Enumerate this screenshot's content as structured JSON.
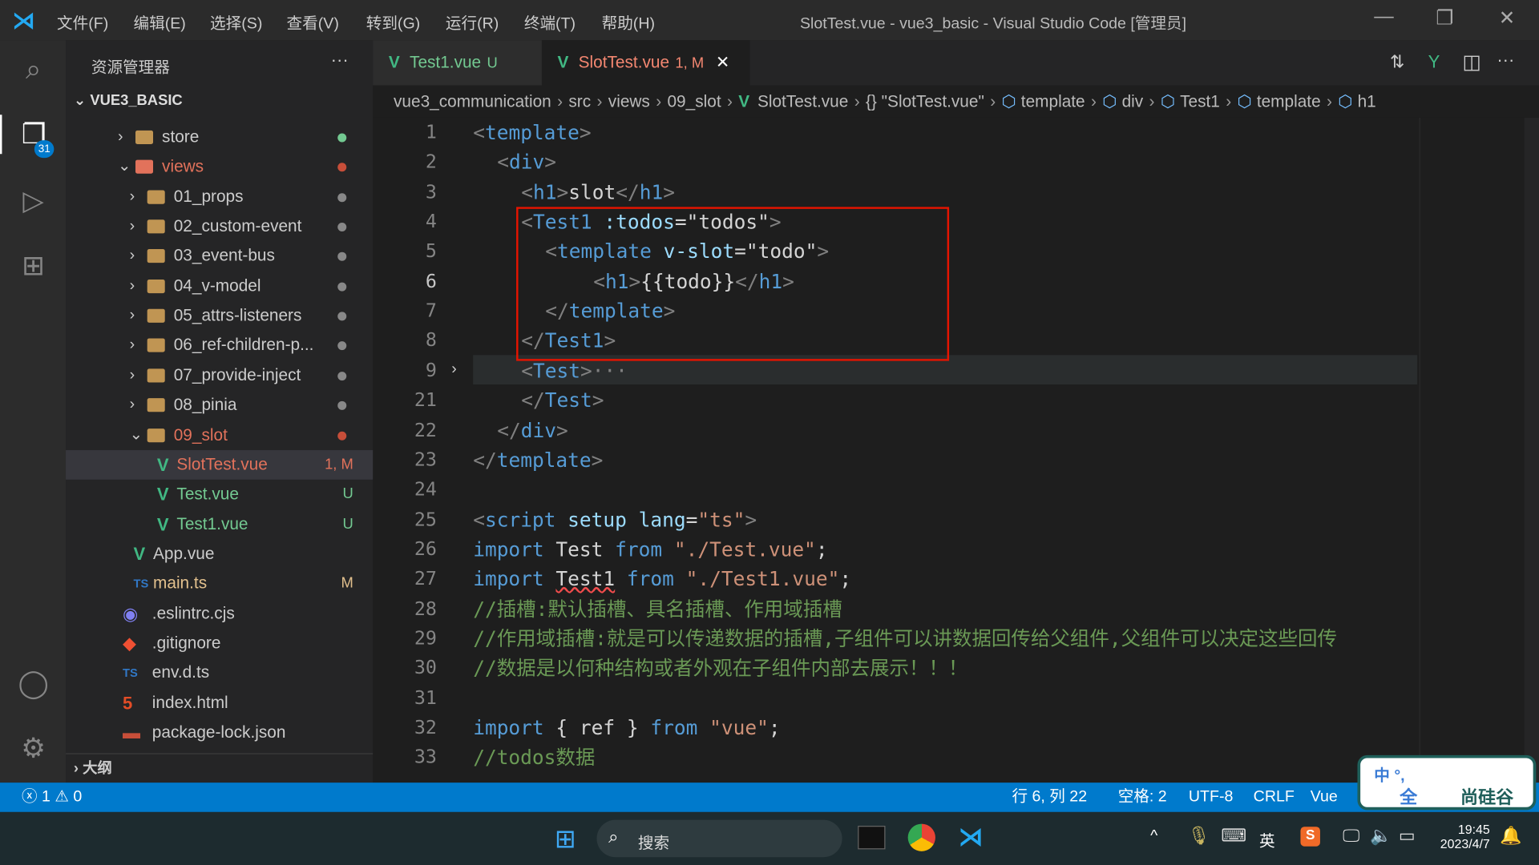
{
  "titlebar": {
    "menus": [
      "文件(F)",
      "编辑(E)",
      "选择(S)",
      "查看(V)",
      "转到(G)",
      "运行(R)",
      "终端(T)",
      "帮助(H)"
    ],
    "title": "SlotTest.vue - vue3_basic - Visual Studio Code [管理员]"
  },
  "activity": {
    "explorer_badge": "31"
  },
  "sidebar": {
    "header": "资源管理器",
    "more": "···",
    "root": "VUE3_BASIC",
    "outline": "大纲",
    "items": [
      {
        "label": "store",
        "type": "folder",
        "level": 0,
        "open": false,
        "dot": "#73c991"
      },
      {
        "label": "views",
        "type": "folder-special",
        "level": 0,
        "open": true,
        "dot": "#c74e39",
        "color": "#e2725b"
      },
      {
        "label": "01_props",
        "type": "folder",
        "level": 1,
        "open": false,
        "dot": "#888"
      },
      {
        "label": "02_custom-event",
        "type": "folder",
        "level": 1,
        "open": false,
        "dot": "#888"
      },
      {
        "label": "03_event-bus",
        "type": "folder",
        "level": 1,
        "open": false,
        "dot": "#888"
      },
      {
        "label": "04_v-model",
        "type": "folder",
        "level": 1,
        "open": false,
        "dot": "#888"
      },
      {
        "label": "05_attrs-listeners",
        "type": "folder",
        "level": 1,
        "open": false,
        "dot": "#888"
      },
      {
        "label": "06_ref-children-p...",
        "type": "folder",
        "level": 1,
        "open": false,
        "dot": "#888"
      },
      {
        "label": "07_provide-inject",
        "type": "folder",
        "level": 1,
        "open": false,
        "dot": "#888"
      },
      {
        "label": "08_pinia",
        "type": "folder",
        "level": 1,
        "open": false,
        "dot": "#888"
      },
      {
        "label": "09_slot",
        "type": "folder",
        "level": 1,
        "open": true,
        "dot": "#c74e39",
        "color": "#e2725b"
      },
      {
        "label": "SlotTest.vue",
        "type": "vue",
        "level": 2,
        "badge": "1, M",
        "color": "#e2725b",
        "selected": true
      },
      {
        "label": "Test.vue",
        "type": "vue",
        "level": 2,
        "badge": "U",
        "color": "#73c991"
      },
      {
        "label": "Test1.vue",
        "type": "vue",
        "level": 2,
        "badge": "U",
        "color": "#73c991"
      },
      {
        "label": "App.vue",
        "type": "vue",
        "level": 1,
        "color": "#ccc"
      },
      {
        "label": "main.ts",
        "type": "ts",
        "level": 1,
        "badge": "M",
        "color": "#e2c08d"
      },
      {
        "label": ".eslintrc.cjs",
        "type": "eslint",
        "level": 0,
        "color": "#ccc"
      },
      {
        "label": ".gitignore",
        "type": "git",
        "level": 0,
        "color": "#ccc"
      },
      {
        "label": "env.d.ts",
        "type": "ts",
        "level": 0,
        "color": "#ccc"
      },
      {
        "label": "index.html",
        "type": "html",
        "level": 0,
        "color": "#ccc"
      },
      {
        "label": "package-lock.json",
        "type": "json",
        "level": 0,
        "color": "#ccc"
      }
    ]
  },
  "tabs": [
    {
      "label": "Test1.vue",
      "status": "U",
      "color": "#73c991"
    },
    {
      "label": "SlotTest.vue",
      "status": "1, M",
      "color": "#f48771",
      "active": true
    }
  ],
  "breadcrumb": [
    "vue3_communication",
    "src",
    "views",
    "09_slot",
    "SlotTest.vue",
    "{} \"SlotTest.vue\"",
    "template",
    "div",
    "Test1",
    "template",
    "h1"
  ],
  "code": [
    {
      "n": "1",
      "i": 0,
      "t": [
        [
          "<",
          "b"
        ],
        [
          "template",
          "t"
        ],
        [
          ">",
          "b"
        ]
      ]
    },
    {
      "n": "2",
      "i": 1,
      "t": [
        [
          "<",
          "b"
        ],
        [
          "div",
          "t"
        ],
        [
          ">",
          "b"
        ]
      ]
    },
    {
      "n": "3",
      "i": 2,
      "t": [
        [
          "<",
          "b"
        ],
        [
          "h1",
          "t"
        ],
        [
          ">",
          "b"
        ],
        [
          "slot",
          "p"
        ],
        [
          "</",
          "b"
        ],
        [
          "h1",
          "t"
        ],
        [
          ">",
          "b"
        ]
      ]
    },
    {
      "n": "4",
      "i": 2,
      "t": [
        [
          "<",
          "b"
        ],
        [
          "Test1",
          "t"
        ],
        [
          " :todos",
          "a"
        ],
        [
          "=",
          "p"
        ],
        [
          "\"todos\"",
          "p"
        ],
        [
          ">",
          "b"
        ]
      ]
    },
    {
      "n": "5",
      "i": 3,
      "t": [
        [
          "<",
          "b"
        ],
        [
          "template",
          "t"
        ],
        [
          " v-slot",
          "a"
        ],
        [
          "=",
          "p"
        ],
        [
          "\"todo\"",
          "p"
        ],
        [
          ">",
          "b"
        ]
      ]
    },
    {
      "n": "6",
      "i": 5,
      "t": [
        [
          "<",
          "b"
        ],
        [
          "h1",
          "t"
        ],
        [
          ">",
          "b"
        ],
        [
          "{{todo}}",
          "p"
        ],
        [
          "</",
          "b"
        ],
        [
          "h1",
          "t"
        ],
        [
          ">",
          "b"
        ]
      ]
    },
    {
      "n": "7",
      "i": 3,
      "t": [
        [
          "</",
          "b"
        ],
        [
          "template",
          "t"
        ],
        [
          ">",
          "b"
        ]
      ]
    },
    {
      "n": "8",
      "i": 2,
      "t": [
        [
          "</",
          "b"
        ],
        [
          "Test1",
          "t"
        ],
        [
          ">",
          "b"
        ]
      ]
    },
    {
      "n": "9",
      "i": 2,
      "t": [
        [
          "<",
          "b"
        ],
        [
          "Test",
          "t"
        ],
        [
          ">",
          "b"
        ],
        [
          "···",
          "b"
        ]
      ]
    },
    {
      "n": "21",
      "i": 2,
      "t": [
        [
          "</",
          "b"
        ],
        [
          "Test",
          "t"
        ],
        [
          ">",
          "b"
        ]
      ]
    },
    {
      "n": "22",
      "i": 1,
      "t": [
        [
          "</",
          "b"
        ],
        [
          "div",
          "t"
        ],
        [
          ">",
          "b"
        ]
      ]
    },
    {
      "n": "23",
      "i": 0,
      "t": [
        [
          "</",
          "b"
        ],
        [
          "template",
          "t"
        ],
        [
          ">",
          "b"
        ]
      ]
    },
    {
      "n": "24",
      "i": 0,
      "t": []
    },
    {
      "n": "25",
      "i": 0,
      "t": [
        [
          "<",
          "b"
        ],
        [
          "script",
          "t"
        ],
        [
          " setup",
          "a"
        ],
        [
          " lang",
          "a"
        ],
        [
          "=",
          "p"
        ],
        [
          "\"ts\"",
          "s"
        ],
        [
          ">",
          "b"
        ]
      ]
    },
    {
      "n": "26",
      "i": 0,
      "t": [
        [
          "import",
          "k"
        ],
        [
          " Test ",
          "p"
        ],
        [
          "from",
          "k"
        ],
        [
          " \"./Test.vue\"",
          "s"
        ],
        [
          ";",
          "p"
        ]
      ]
    },
    {
      "n": "27",
      "i": 0,
      "t": [
        [
          "import",
          "k"
        ],
        [
          " ",
          "p"
        ],
        [
          "Test1",
          "e"
        ],
        [
          " ",
          "p"
        ],
        [
          "from",
          "k"
        ],
        [
          " \"./Test1.vue\"",
          "s"
        ],
        [
          ";",
          "p"
        ]
      ]
    },
    {
      "n": "28",
      "i": 0,
      "t": [
        [
          "//插槽:默认插槽、具名插槽、作用域插槽",
          "c"
        ]
      ]
    },
    {
      "n": "29",
      "i": 0,
      "t": [
        [
          "//作用域插槽:就是可以传递数据的插槽,子组件可以讲数据回传给父组件,父组件可以决定这些回传",
          "c"
        ]
      ]
    },
    {
      "n": "30",
      "i": 0,
      "t": [
        [
          "//数据是以何种结构或者外观在子组件内部去展示！！！",
          "c"
        ]
      ]
    },
    {
      "n": "31",
      "i": 0,
      "t": []
    },
    {
      "n": "32",
      "i": 0,
      "t": [
        [
          "import",
          "k"
        ],
        [
          " { ref } ",
          "p"
        ],
        [
          "from",
          "k"
        ],
        [
          " \"vue\"",
          "s"
        ],
        [
          ";",
          "p"
        ]
      ]
    },
    {
      "n": "33",
      "i": 0,
      "t": [
        [
          "//todos数据",
          "c"
        ]
      ]
    }
  ],
  "statusbar": {
    "errors": "1",
    "warnings": "0",
    "position": "行 6, 列 22",
    "spaces": "空格: 2",
    "encoding": "UTF-8",
    "eol": "CRLF",
    "language": "Vue"
  },
  "ime": {
    "line1": "中 °, ",
    "line2": "全",
    "brand": "尚硅谷"
  },
  "taskbar": {
    "search": "搜索",
    "ime_lang": "英",
    "time": "19:45",
    "date": "2023/4/7"
  },
  "colors": {
    "accent": "#007acc",
    "vue": "#41b883",
    "highlight_box": "#e51400"
  }
}
